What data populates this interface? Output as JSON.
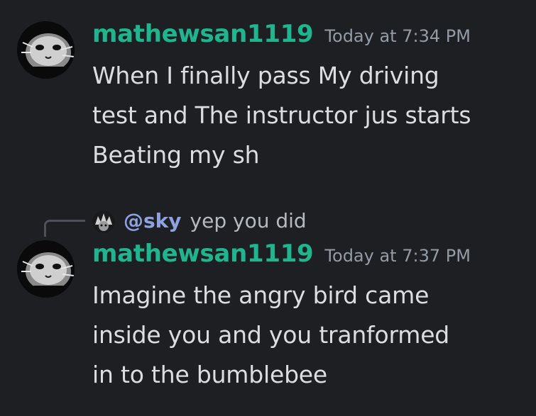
{
  "messages": [
    {
      "username": "mathewsan1119",
      "timestamp": "Today at 7:34 PM",
      "lines": [
        "When I finally pass My driving",
        "test and The instructor jus starts",
        "Beating my sh"
      ],
      "avatar_icon": "cat-face-avatar-icon"
    },
    {
      "reply": {
        "mention": "@sky",
        "snippet": "yep you did",
        "avatar_icon": "spiky-avatar-icon"
      },
      "username": "mathewsan1119",
      "timestamp": "Today at 7:37 PM",
      "lines": [
        "Imagine the angry bird  came",
        "inside you and you  tranformed",
        "in to the bumblebee"
      ],
      "avatar_icon": "cat-face-avatar-icon"
    }
  ],
  "colors": {
    "background": "#1e1f22",
    "username": "#1fb58f",
    "timestamp": "#949ba4",
    "message_text": "#dbdee1",
    "mention": "#8ea1e1"
  }
}
